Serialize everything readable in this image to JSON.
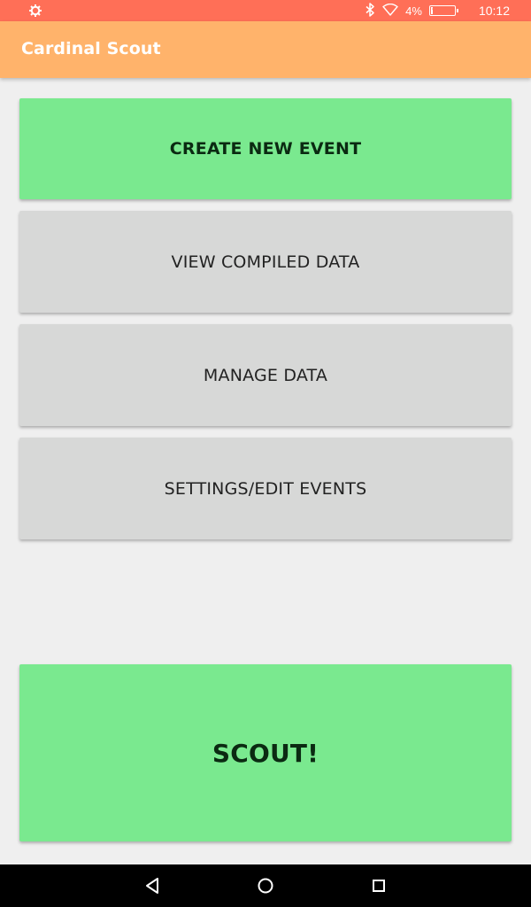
{
  "status_bar": {
    "battery_percent": "4%",
    "battery_level": 0.04,
    "time": "10:12",
    "icons": [
      "settings-icon",
      "bluetooth-icon",
      "wifi-icon",
      "battery-icon"
    ]
  },
  "app_bar": {
    "title": "Cardinal Scout"
  },
  "main": {
    "create_label": "CREATE NEW EVENT",
    "view_label": "VIEW COMPILED DATA",
    "manage_label": "MANAGE DATA",
    "settings_label": "SETTINGS/EDIT EVENTS",
    "scout_label": "SCOUT!"
  },
  "colors": {
    "status_bar": "#ff6f57",
    "app_bar": "#ffb36b",
    "green_button": "#7ae98f",
    "gray_button": "#d7d8d7",
    "background": "#efefef"
  },
  "nav_bar": {
    "icons": [
      "back-icon",
      "home-icon",
      "recent-apps-icon"
    ]
  }
}
